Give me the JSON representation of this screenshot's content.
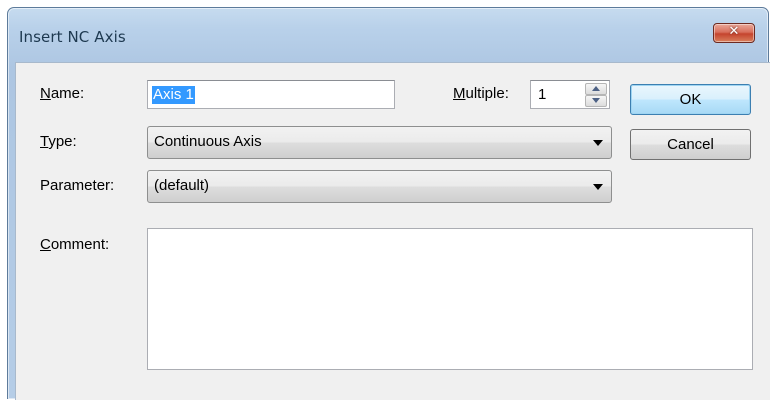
{
  "window": {
    "title": "Insert NC Axis",
    "close_glyph": "✕",
    "close_icon": "close-icon"
  },
  "form": {
    "name": {
      "label_key": "N",
      "label_rest": "ame:",
      "value": "Axis 1"
    },
    "multiple": {
      "label_key": "M",
      "label_rest": "ultiple:",
      "value": "1"
    },
    "type": {
      "label_key": "T",
      "label_rest": "ype:",
      "selected": "Continuous Axis"
    },
    "parameter": {
      "label": "Parameter:",
      "selected": "(default)"
    },
    "comment": {
      "label_key": "C",
      "label_rest": "omment:",
      "value": ""
    }
  },
  "buttons": {
    "ok": "OK",
    "cancel": "Cancel"
  },
  "colors": {
    "title_bar": "#b9d1ea",
    "client_bg": "#f0f0f0",
    "selection": "#3399ff",
    "close_red": "#c5442e"
  }
}
